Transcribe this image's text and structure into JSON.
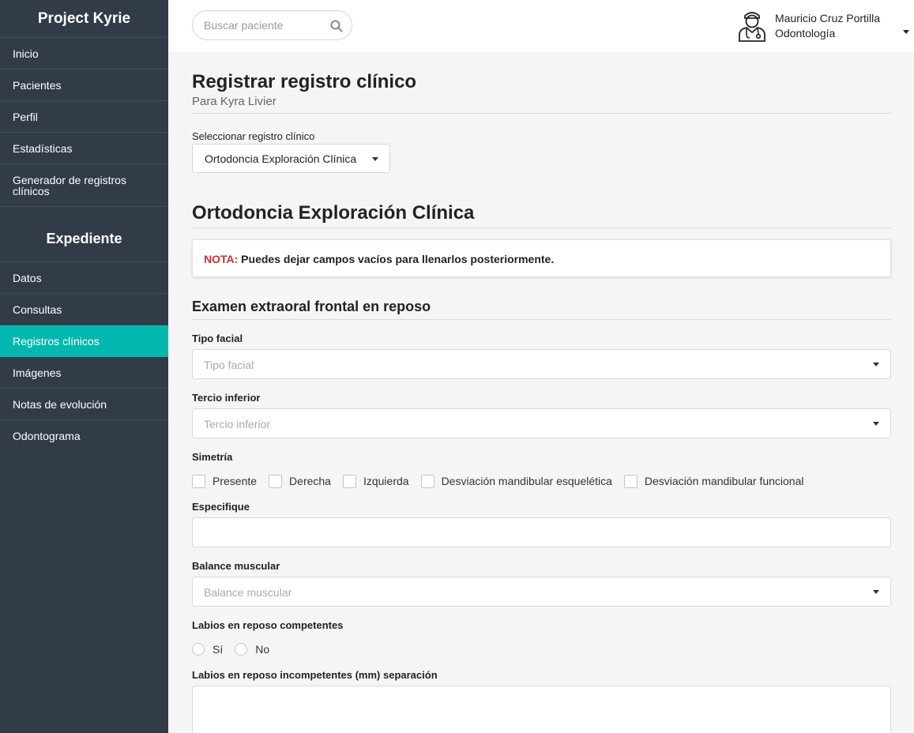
{
  "sidebar": {
    "brand": "Project Kyrie",
    "items": [
      {
        "label": "Inicio"
      },
      {
        "label": "Pacientes"
      },
      {
        "label": "Perfil"
      },
      {
        "label": "Estadísticas"
      },
      {
        "label": "Generador de registros clínicos"
      }
    ],
    "section_title": "Expediente",
    "section_items": [
      {
        "label": "Datos"
      },
      {
        "label": "Consultas"
      },
      {
        "label": "Registros clínicos",
        "active": true
      },
      {
        "label": "Imágenes"
      },
      {
        "label": "Notas de evolución"
      },
      {
        "label": "Odontograma"
      }
    ]
  },
  "topbar": {
    "search_placeholder": "Buscar paciente",
    "user_name": "Mauricio Cruz Portilla",
    "user_role": "Odontología"
  },
  "main": {
    "title": "Registrar registro clínico",
    "subtitle": "Para Kyra Livier",
    "select_label": "Seleccionar registro clínico",
    "select_value": "Ortodoncia Exploración Clínica",
    "section_title": "Ortodoncia Exploración Clínica",
    "note_prefix": "NOTA:",
    "note_text": " Puedes dejar campos vacíos para llenarlos posteriormente.",
    "subsection_title": "Examen extraoral frontal en reposo",
    "fields": {
      "tipo_facial": {
        "label": "Tipo facial",
        "placeholder": "Tipo facial"
      },
      "tercio_inferior": {
        "label": "Tercio inferior",
        "placeholder": "Tercio inferior"
      },
      "simetria": {
        "label": "Simetría",
        "options": [
          "Presente",
          "Derecha",
          "Izquierda",
          "Desviación mandibular esquelética",
          "Desviación mandibular funcional"
        ]
      },
      "especifique": {
        "label": "Especifique"
      },
      "balance_muscular": {
        "label": "Balance muscular",
        "placeholder": "Balance muscular"
      },
      "labios_competentes": {
        "label": "Labios en reposo competentes",
        "options": [
          "Sí",
          "No"
        ]
      },
      "labios_incompetentes": {
        "label": "Labios en reposo incompetentes (mm) separación"
      }
    }
  },
  "colors": {
    "sidebar_bg": "#323b48",
    "accent": "#00b8ad",
    "note_red": "#d32f2f"
  }
}
